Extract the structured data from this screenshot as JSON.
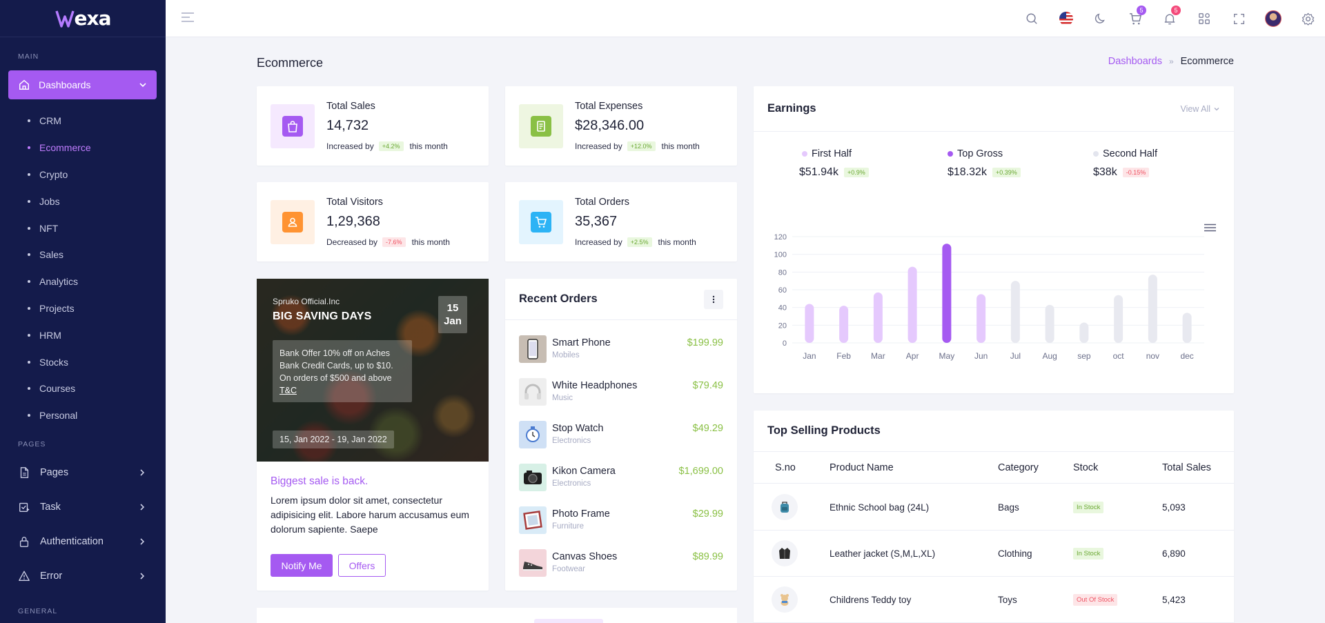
{
  "sidebar": {
    "logo": "exa",
    "section_main": "MAIN",
    "dashboards_label": "Dashboards",
    "submenu": [
      {
        "label": "CRM",
        "active": false
      },
      {
        "label": "Ecommerce",
        "active": true
      },
      {
        "label": "Crypto",
        "active": false
      },
      {
        "label": "Jobs",
        "active": false
      },
      {
        "label": "NFT",
        "active": false
      },
      {
        "label": "Sales",
        "active": false
      },
      {
        "label": "Analytics",
        "active": false
      },
      {
        "label": "Projects",
        "active": false
      },
      {
        "label": "HRM",
        "active": false
      },
      {
        "label": "Stocks",
        "active": false
      },
      {
        "label": "Courses",
        "active": false
      },
      {
        "label": "Personal",
        "active": false
      }
    ],
    "section_pages": "PAGES",
    "nav": [
      {
        "label": "Pages",
        "icon": "file-icon"
      },
      {
        "label": "Task",
        "icon": "task-icon"
      },
      {
        "label": "Authentication",
        "icon": "lock-icon"
      },
      {
        "label": "Error",
        "icon": "warning-icon"
      }
    ],
    "section_general": "GENERAL"
  },
  "header": {
    "cart_count": "5",
    "notif_count": "5"
  },
  "page": {
    "title": "Ecommerce",
    "breadcrumb_link": "Dashboards",
    "breadcrumb_current": "Ecommerce"
  },
  "stats": [
    {
      "title": "Total Sales",
      "value": "14,732",
      "prefix": "Increased by",
      "change": "+4.2%",
      "suffix": "this month",
      "trend": "up",
      "icon": "bag-icon",
      "bg": "#f5e9fe",
      "fg": "#a55af1"
    },
    {
      "title": "Total Expenses",
      "value": "$28,346.00",
      "prefix": "Increased by",
      "change": "+12.0%",
      "suffix": "this month",
      "trend": "up",
      "icon": "receipt-icon",
      "bg": "#eef6e1",
      "fg": "#8ac045"
    },
    {
      "title": "Total Visitors",
      "value": "1,29,368",
      "prefix": "Decreased by",
      "change": "-7.6%",
      "suffix": "this month",
      "trend": "down",
      "icon": "user-icon",
      "bg": "#fff0e3",
      "fg": "#ff9332"
    },
    {
      "title": "Total Orders",
      "value": "35,367",
      "prefix": "Increased by",
      "change": "+2.5%",
      "suffix": "this month",
      "trend": "up",
      "icon": "cart-icon",
      "bg": "#e3f4fe",
      "fg": "#2cb3f5"
    }
  ],
  "promo": {
    "org": "Spruko Official.Inc",
    "headline": "BIG SAVING DAYS",
    "date_day": "15",
    "date_month": "Jan",
    "offer_line1": "Bank Offer 10% off on Aches",
    "offer_line2": "Bank Credit Cards, up to $10.",
    "offer_line3": "On orders of $500 and above",
    "offer_tc": "T&C",
    "range": "15, Jan 2022 - 19, Jan 2022",
    "title": "Biggest sale is back.",
    "desc": "Lorem ipsum dolor sit amet, consectetur adipisicing elit. Labore harum accusamus eum dolorum sapiente. Saepe",
    "notify_label": "Notify Me",
    "offers_label": "Offers"
  },
  "recent_orders": {
    "title": "Recent Orders",
    "items": [
      {
        "name": "Smart Phone",
        "category": "Mobiles",
        "price": "$199.99",
        "thumb": "phone-icon"
      },
      {
        "name": "White Headphones",
        "category": "Music",
        "price": "$79.49",
        "thumb": "headphones-icon"
      },
      {
        "name": "Stop Watch",
        "category": "Electronics",
        "price": "$49.29",
        "thumb": "watch-icon"
      },
      {
        "name": "Kikon Camera",
        "category": "Electronics",
        "price": "$1,699.00",
        "thumb": "camera-icon"
      },
      {
        "name": "Photo Frame",
        "category": "Furniture",
        "price": "$29.99",
        "thumb": "frame-icon"
      },
      {
        "name": "Canvas Shoes",
        "category": "Footwear",
        "price": "$89.99",
        "thumb": "shoes-icon"
      }
    ]
  },
  "earnings": {
    "title": "Earnings",
    "view_all": "View All",
    "legend": [
      {
        "name": "First Half",
        "value": "$51.94k",
        "change": "+0.9%",
        "trend": "up",
        "color": "#e5c9fd"
      },
      {
        "name": "Top Gross",
        "value": "$18.32k",
        "change": "+0.39%",
        "trend": "up",
        "color": "#a55af1"
      },
      {
        "name": "Second Half",
        "value": "$38k",
        "change": "-0.15%",
        "trend": "down",
        "color": "#e3e5ee"
      }
    ]
  },
  "chart_data": {
    "type": "bar",
    "categories": [
      "Jan",
      "Feb",
      "Mar",
      "Apr",
      "May",
      "Jun",
      "Jul",
      "Aug",
      "sep",
      "oct",
      "nov",
      "dec"
    ],
    "values": [
      44,
      42,
      57,
      86,
      112,
      55,
      70,
      43,
      23,
      54,
      77,
      34
    ],
    "highlight_index": 4,
    "ylim": [
      0,
      120
    ],
    "yticks": [
      0,
      20,
      40,
      60,
      80,
      100,
      120
    ],
    "grid": true,
    "colors": {
      "first_half": "#e5c9fd",
      "highlight": "#a55af1",
      "second_half": "#e8e9f0"
    }
  },
  "top_selling": {
    "title": "Top Selling Products",
    "headers": [
      "S.no",
      "Product Name",
      "Category",
      "Stock",
      "Total Sales"
    ],
    "rows": [
      {
        "icon": "backpack-icon",
        "name": "Ethnic School bag (24L)",
        "category": "Bags",
        "stock": "In Stock",
        "in_stock": true,
        "sales": "5,093"
      },
      {
        "icon": "jacket-icon",
        "name": "Leather jacket (S,M,L,XL)",
        "category": "Clothing",
        "stock": "In Stock",
        "in_stock": true,
        "sales": "6,890"
      },
      {
        "icon": "teddy-icon",
        "name": "Childrens Teddy toy",
        "category": "Toys",
        "stock": "Out Of Stock",
        "in_stock": false,
        "sales": "5,423"
      }
    ]
  }
}
